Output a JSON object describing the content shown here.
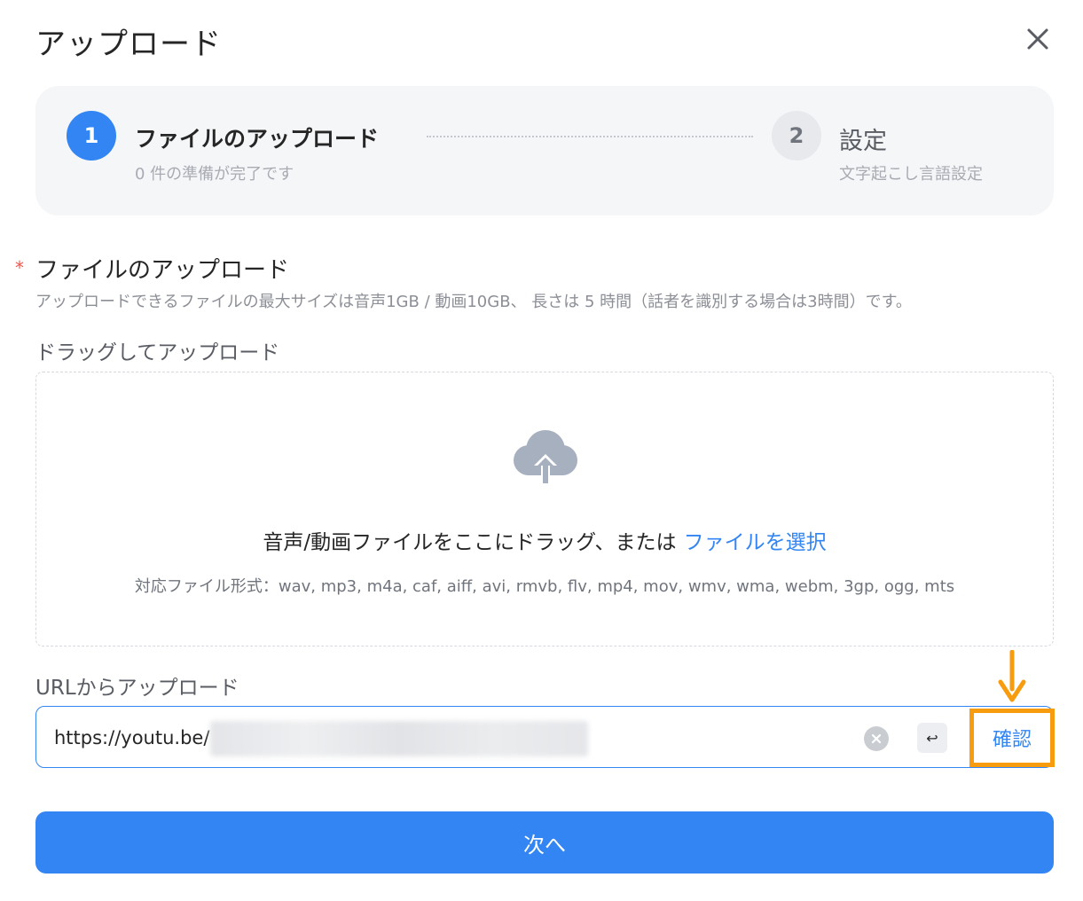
{
  "dialog": {
    "title": "アップロード"
  },
  "steps": [
    {
      "number": "1",
      "title": "ファイルのアップロード",
      "subtitle": "0 件の準備が完了です"
    },
    {
      "number": "2",
      "title": "設定",
      "subtitle": "文字起こし言語設定"
    }
  ],
  "upload": {
    "required_mark": "*",
    "title": "ファイルのアップロード",
    "description": "アップロードできるファイルの最大サイズは音声1GB / 動画10GB、 長さは 5 時間（話者を識別する場合は3時間）です。",
    "drag_label": "ドラッグしてアップロード",
    "drop_text": "音声/動画ファイルをここにドラッグ、または",
    "select_link": "ファイルを選択",
    "formats": "対応ファイル形式：wav, mp3, m4a, caf, aiff, avi, rmvb, flv, mp4, mov, wmv, wma, webm, 3gp, ogg, mts"
  },
  "url_upload": {
    "label": "URLからアップロード",
    "value": "https://youtu.be/",
    "enter_symbol": "↩",
    "confirm_label": "確認"
  },
  "footer": {
    "next_label": "次へ"
  },
  "colors": {
    "primary": "#3285f2",
    "highlight": "#f79c0f",
    "required": "#f0564c",
    "step_panel_bg": "#f5f6f8"
  },
  "icons": {
    "close": "close-icon",
    "upload": "cloud-upload-icon",
    "clear": "clear-circle-icon",
    "enter": "enter-icon",
    "annotation": "arrow-down-icon"
  }
}
